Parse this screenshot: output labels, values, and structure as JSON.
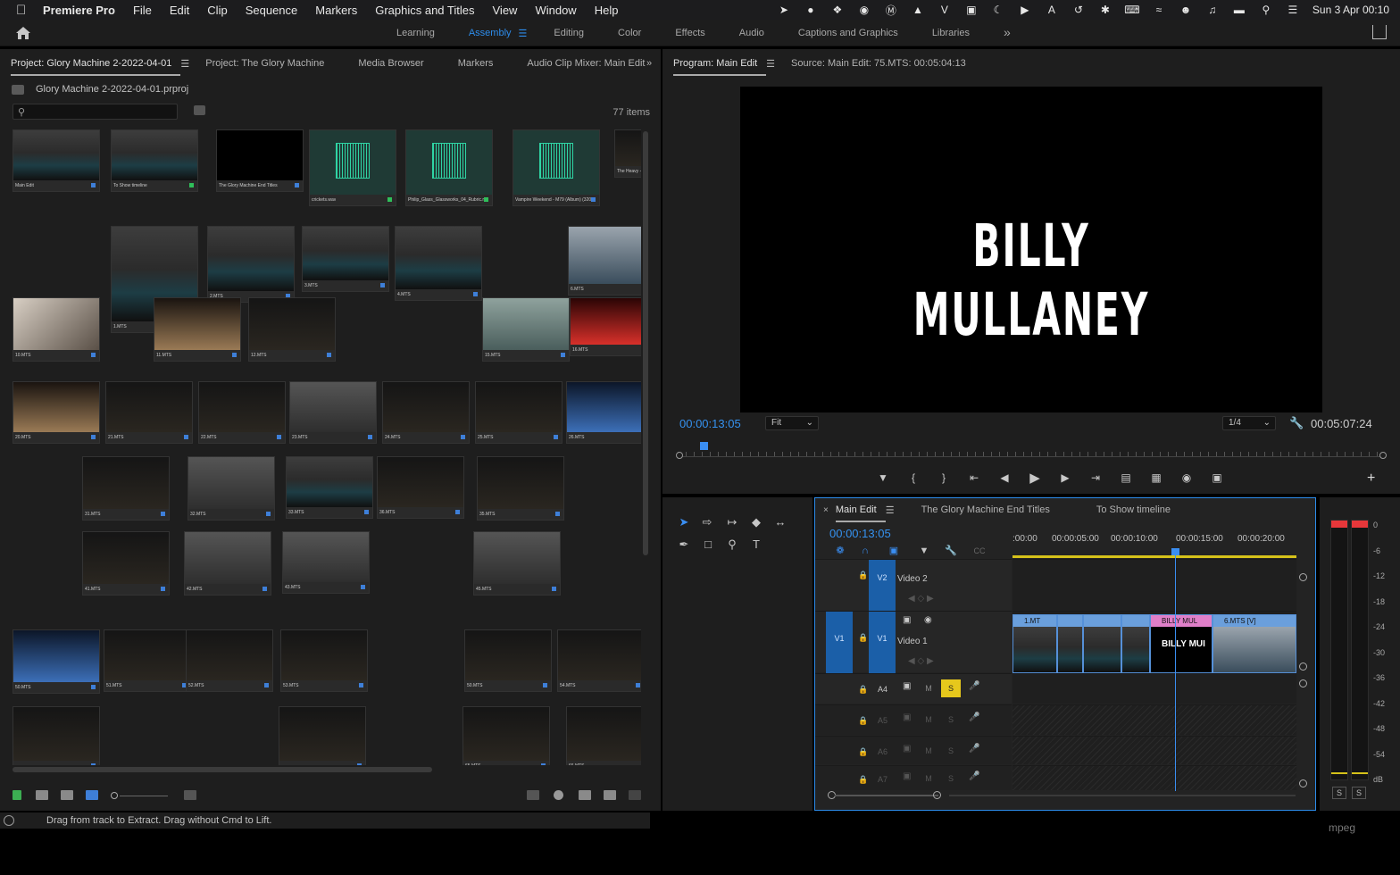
{
  "menubar": {
    "app": "Premiere Pro",
    "items": [
      "File",
      "Edit",
      "Clip",
      "Sequence",
      "Markers",
      "Graphics and Titles",
      "View",
      "Window",
      "Help"
    ],
    "datetime": "Sun 3 Apr  00:10"
  },
  "workspaces": {
    "tabs": [
      "Learning",
      "Assembly",
      "Editing",
      "Color",
      "Effects",
      "Audio",
      "Captions and Graphics",
      "Libraries"
    ],
    "active": "Assembly"
  },
  "project": {
    "tabs": [
      "Project: Glory Machine 2-2022-04-01",
      "Project: The Glory Machine",
      "Media Browser",
      "Markers",
      "Audio Clip Mixer: Main Edit"
    ],
    "file": "Glory Machine 2-2022-04-01.prproj",
    "search_placeholder": "",
    "items_count": "77 items"
  },
  "clips": [
    {
      "label": "Main Edit",
      "tone": "bed"
    },
    {
      "label": "To Show timeline",
      "tone": "bed"
    },
    {
      "label": "The Glory Machine End Titles",
      "tone": "title"
    },
    {
      "label": "crickets.wav",
      "tone": "audio"
    },
    {
      "label": "Philip_Glass_Glassworks_04_Rubric.mp3",
      "tone": "audio"
    },
    {
      "label": "Vampire Weekend - M79 (Album) (320 kbps) (download-lagu-",
      "tone": "audio"
    },
    {
      "label": "The Heavy - Short Change Hero (1 Hour)",
      "tone": "dark"
    },
    {
      "label": "1.MTS",
      "tone": "bed"
    },
    {
      "label": "2.MTS",
      "tone": "bed"
    },
    {
      "label": "3.MTS",
      "tone": "bed"
    },
    {
      "label": "4.MTS",
      "tone": "bed"
    },
    {
      "label": "6.MTS",
      "tone": "sleep"
    },
    {
      "label": "10.MTS",
      "tone": "hand"
    },
    {
      "label": "11.MTS",
      "tone": "sand"
    },
    {
      "label": "12.MTS",
      "tone": "dark"
    },
    {
      "label": "15.MTS",
      "tone": "water"
    },
    {
      "label": "16.MTS",
      "tone": "red"
    },
    {
      "label": "20.MTS",
      "tone": "sand"
    },
    {
      "label": "21.MTS",
      "tone": "dark"
    },
    {
      "label": "22.MTS",
      "tone": "dark"
    },
    {
      "label": "23.MTS",
      "tone": "grey"
    },
    {
      "label": "24.MTS",
      "tone": "dark"
    },
    {
      "label": "25.MTS",
      "tone": "dark"
    },
    {
      "label": "26.MTS",
      "tone": "blue"
    },
    {
      "label": "31.MTS",
      "tone": "dark"
    },
    {
      "label": "32.MTS",
      "tone": "grey"
    },
    {
      "label": "33.MTS",
      "tone": "bed"
    },
    {
      "label": "36.MTS",
      "tone": "dark"
    },
    {
      "label": "35.MTS",
      "tone": "dark"
    },
    {
      "label": "41.MTS",
      "tone": "dark"
    },
    {
      "label": "42.MTS",
      "tone": "grey"
    },
    {
      "label": "43.MTS",
      "tone": "grey"
    },
    {
      "label": "45.MTS",
      "tone": "grey"
    },
    {
      "label": "50.MTS",
      "tone": "blue"
    },
    {
      "label": "51.MTS",
      "tone": "dark"
    },
    {
      "label": "52.MTS",
      "tone": "dark"
    },
    {
      "label": "53.MTS",
      "tone": "dark"
    },
    {
      "label": "50.MTS",
      "tone": "dark"
    },
    {
      "label": "54.MTS",
      "tone": "dark"
    },
    {
      "label": "",
      "tone": "dark"
    },
    {
      "label": "",
      "tone": "dark"
    },
    {
      "label": "65.MTS",
      "tone": "dark"
    },
    {
      "label": "66.MTS",
      "tone": "dark"
    }
  ],
  "program": {
    "tab": "Program: Main Edit",
    "source": "Source: Main Edit: 75.MTS: 00:05:04:13",
    "title_card": "BILLY MULLANEY",
    "timecode": "00:00:13:05",
    "fit": "Fit",
    "quality": "1/4",
    "duration": "00:05:07:24"
  },
  "timeline": {
    "tabs": [
      "Main Edit",
      "The Glory Machine End Titles",
      "To Show timeline"
    ],
    "timecode": "00:00:13:05",
    "ruler": [
      ":00:00",
      "00:00:05:00",
      "00:00:10:00",
      "00:00:15:00",
      "00:00:20:00"
    ],
    "v2": {
      "src": "",
      "tgt": "V2",
      "name": "Video 2"
    },
    "v1": {
      "src": "V1",
      "tgt": "V1",
      "name": "Video 1"
    },
    "a4": "A4",
    "a5": "A5",
    "a6": "A6",
    "a7": "A7",
    "m": "M",
    "s": "S",
    "clips": [
      {
        "label": "1.MT",
        "tone": "bed"
      },
      {
        "label": "",
        "tone": "bed"
      },
      {
        "label": "",
        "tone": "bed"
      },
      {
        "label": "",
        "tone": "bed"
      },
      {
        "label": "BILLY MUL",
        "tone": "title",
        "thumb": "BILLY MUI"
      },
      {
        "label": "6.MTS [V]",
        "tone": "sleep"
      }
    ]
  },
  "meters": {
    "scale": [
      "0",
      "-6",
      "-12",
      "-18",
      "-24",
      "-30",
      "-36",
      "-42",
      "-48",
      "-54",
      "dB"
    ],
    "solo": "S"
  },
  "status": {
    "text": "Drag from track to Extract. Drag without Cmd to Lift.",
    "dock_peek": "mpeg"
  },
  "colors": {
    "accent": "#2d8ceb",
    "solo_on": "#e6c81c",
    "title_clip": "#e07fc9",
    "video_clip": "#6a9fdc"
  }
}
